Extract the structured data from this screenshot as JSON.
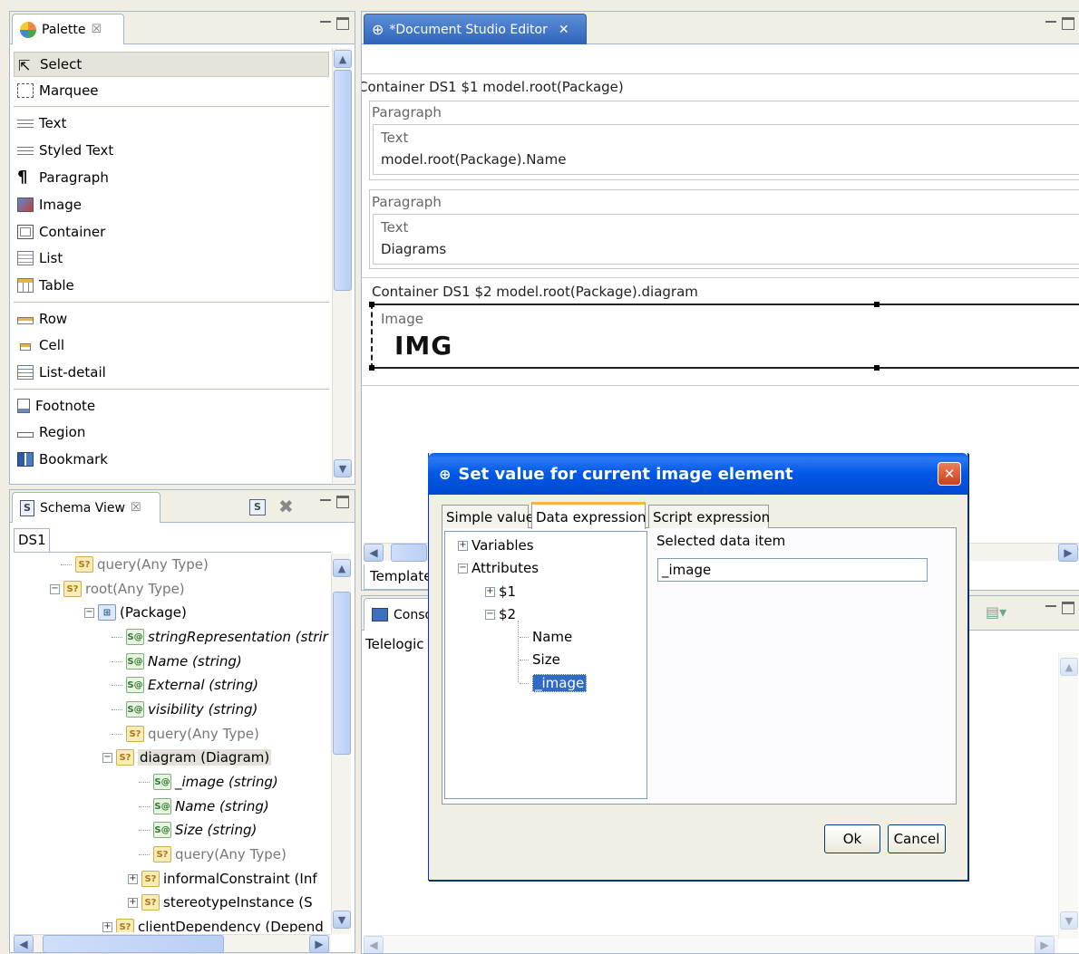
{
  "palette": {
    "title": "Palette",
    "items": [
      "Select",
      "Marquee",
      "Text",
      "Styled Text",
      "Paragraph",
      "Image",
      "Container",
      "List",
      "Table",
      "Row",
      "Cell",
      "List-detail",
      "Footnote",
      "Region",
      "Bookmark"
    ]
  },
  "schema": {
    "title": "Schema View",
    "tab": "DS1",
    "rows": [
      {
        "label": "query(Any Type)",
        "style": "q",
        "icon": "q"
      },
      {
        "label": "root(Any Type)",
        "style": "q",
        "icon": "q"
      },
      {
        "label": "(Package)",
        "style": "n",
        "icon": "p"
      },
      {
        "label": "stringRepresentation (strir",
        "style": "it",
        "icon": "a"
      },
      {
        "label": "Name (string)",
        "style": "it",
        "icon": "a"
      },
      {
        "label": "External (string)",
        "style": "it",
        "icon": "a"
      },
      {
        "label": "visibility (string)",
        "style": "it",
        "icon": "a"
      },
      {
        "label": "query(Any Type)",
        "style": "q",
        "icon": "q"
      },
      {
        "label": "diagram (Diagram)",
        "style": "n",
        "icon": "q"
      },
      {
        "label": "_image (string)",
        "style": "it",
        "icon": "a"
      },
      {
        "label": "Name (string)",
        "style": "it",
        "icon": "a"
      },
      {
        "label": "Size (string)",
        "style": "it",
        "icon": "a"
      },
      {
        "label": "query(Any Type)",
        "style": "q",
        "icon": "q"
      },
      {
        "label": "informalConstraint (Inf",
        "style": "n",
        "icon": "q"
      },
      {
        "label": "stereotypeInstance (S",
        "style": "n",
        "icon": "q"
      },
      {
        "label": "clientDependency (Depend",
        "style": "n",
        "icon": "q"
      }
    ]
  },
  "editor": {
    "tab": "*Document Studio Editor",
    "container1": "Container DS1   $1   model.root(Package)",
    "paragraph1": "Paragraph",
    "text1_label": "Text",
    "text1_value": "model.root(Package).Name",
    "paragraph2": "Paragraph",
    "text2_label": "Text",
    "text2_value": "Diagrams",
    "container2": "Container DS1   $2   model.root(Package).diagram",
    "image_label": "Image",
    "image_value": "IMG",
    "template_tab": "Template"
  },
  "console": {
    "title": "Conso",
    "line": "Telelogic F"
  },
  "dialog": {
    "title": "Set value for current image element",
    "tabs": [
      "Simple value",
      "Data expression",
      "Script expression"
    ],
    "tree": {
      "variables": "Variables",
      "attributes": "Attributes",
      "d1": "$1",
      "d2": "$2",
      "name": "Name",
      "size": "Size",
      "image": "_image"
    },
    "selected_label": "Selected data item",
    "selected_value": "_image",
    "ok": "Ok",
    "cancel": "Cancel"
  }
}
